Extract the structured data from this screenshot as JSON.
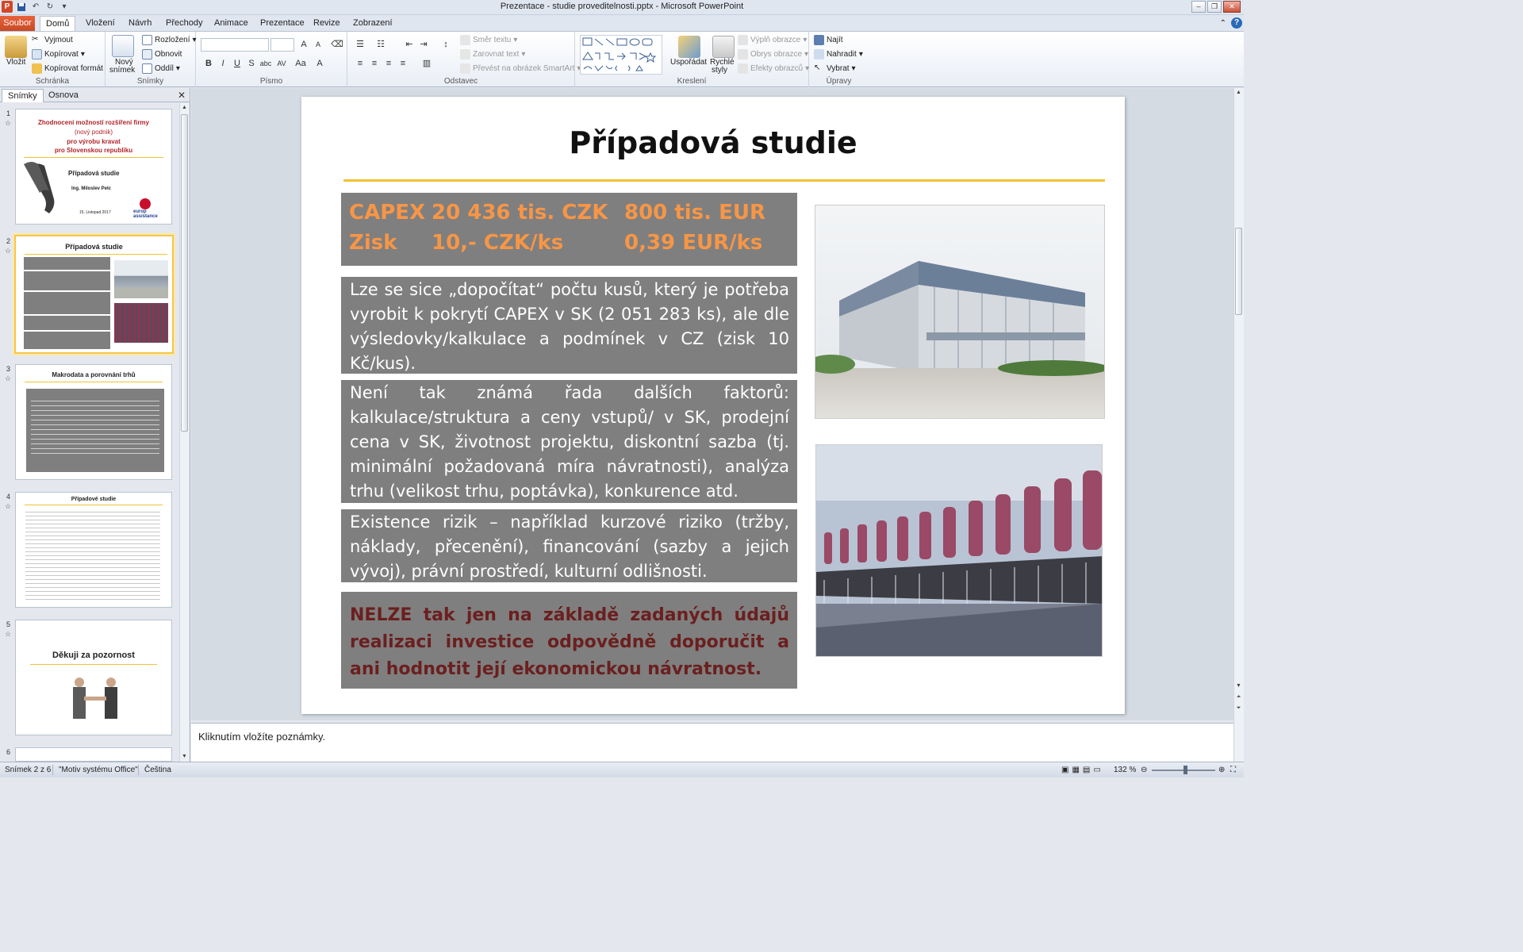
{
  "window": {
    "title": "Prezentace - studie proveditelnosti.pptx  -  Microsoft PowerPoint"
  },
  "tabs": [
    "Soubor",
    "Domů",
    "Vložení",
    "Návrh",
    "Přechody",
    "Animace",
    "Prezentace",
    "Revize",
    "Zobrazení"
  ],
  "ribbon": {
    "clipboard": {
      "paste": "Vložit",
      "cut": "Vyjmout",
      "copy": "Kopírovat",
      "format_painter": "Kopírovat formát",
      "label": "Schránka"
    },
    "slides": {
      "new_slide_1": "Nový",
      "new_slide_2": "snímek",
      "layout": "Rozložení",
      "reset": "Obnovit",
      "section": "Oddíl",
      "label": "Snímky"
    },
    "font": {
      "label": "Písmo"
    },
    "paragraph": {
      "text_direction": "Směr textu",
      "align_text": "Zarovnat text",
      "smartart": "Převést na obrázek SmartArt",
      "label": "Odstavec"
    },
    "drawing": {
      "arrange": "Uspořádat",
      "quick_styles_1": "Rychlé",
      "quick_styles_2": "styly",
      "shape_fill": "Výplň obrazce",
      "shape_outline": "Obrys obrazce",
      "shape_effects": "Efekty obrazců",
      "label": "Kreslení"
    },
    "editing": {
      "find": "Najít",
      "replace": "Nahradit",
      "select": "Vybrat",
      "label": "Úpravy"
    }
  },
  "panel": {
    "tab_slides": "Snímky",
    "tab_outline": "Osnova"
  },
  "thumbnails": [
    {
      "num": "1",
      "title": "Zhodnocení  možností rozšíření firmy",
      "sub1": "(nový podnik)",
      "sub2": "pro výrobu kravat",
      "sub3": "pro Slovenskou republiku",
      "heading": "Případová studie",
      "author": "Ing. Miloslev Pelc",
      "date": "15. Listopad 2017",
      "logo": "europ assistance"
    },
    {
      "num": "2",
      "title": "Případová studie"
    },
    {
      "num": "3",
      "title": "Makrodata a porovnání trhů"
    },
    {
      "num": "4",
      "title": "Případové studie"
    },
    {
      "num": "5",
      "title": "Děkuji za pozornost"
    },
    {
      "num": "6"
    }
  ],
  "slide": {
    "title": "Případová studie",
    "capex_label": "CAPEX",
    "capex_czk": "20 436 tis. CZK",
    "capex_eur": "800 tis. EUR",
    "zisk_label": "Zisk",
    "zisk_czk": "10,- CZK/ks",
    "zisk_eur": "0,39 EUR/ks",
    "para1": "Lze se sice „dopočítat“ počtu kusů, který je potřeba vyrobit k pokrytí CAPEX v SK (2 051 283 ks), ale dle výsledovky/kalkulace a podmínek v CZ (zisk 10 Kč/kus).",
    "para2": "Není tak známá řada dalších faktorů: kalkulace/struktura a ceny vstupů/ v SK, prodejní cena v SK, životnost projektu, diskontní sazba (tj. minimální požadovaná míra návratnosti), analýza trhu (velikost trhu, poptávka), konkurence atd.",
    "para3": "Existence rizik – například kurzové riziko (tržby, náklady, přecenění), financování (sazby a jejich vývoj), právní prostředí, kulturní odlišnosti.",
    "para4": "NELZE tak jen na základě zadaných údajů realizaci investice odpovědně doporučit a ani hodnotit její ekonomickou návratnost.",
    "title_line_color": "#f1c232",
    "capex_color": "#f79646",
    "box_color": "#7f7f7f",
    "red_color": "#6b1f1f"
  },
  "notes": {
    "placeholder": "Kliknutím vložíte poznámky."
  },
  "status": {
    "slide": "Snímek 2 z 6",
    "theme": "\"Motiv systému Office\"",
    "lang": "Čeština",
    "zoom": "132 %"
  }
}
